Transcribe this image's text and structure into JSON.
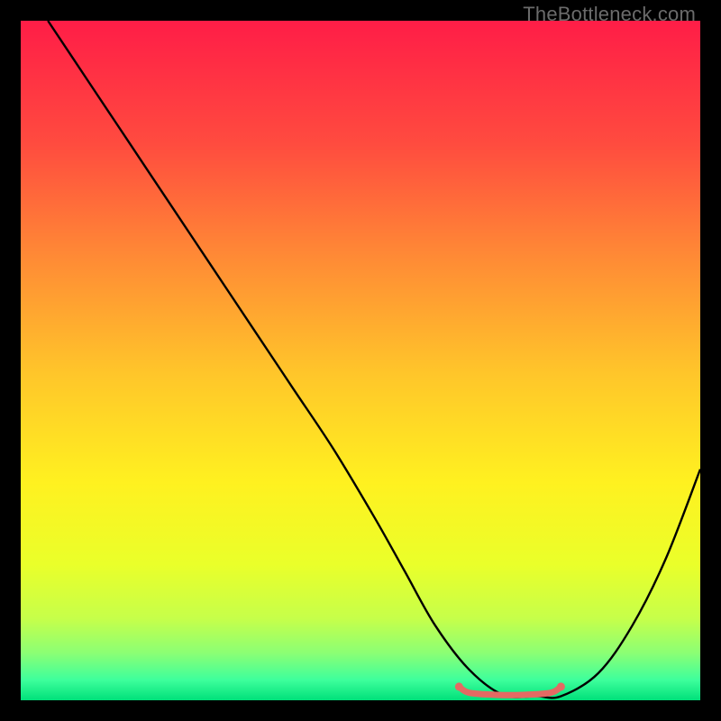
{
  "watermark": "TheBottleneck.com",
  "chart_data": {
    "type": "line",
    "title": "",
    "xlabel": "",
    "ylabel": "",
    "xlim": [
      0,
      100
    ],
    "ylim": [
      0,
      100
    ],
    "grid": false,
    "legend": false,
    "background_gradient": {
      "stops": [
        {
          "offset": 0.0,
          "color": "#ff1d47"
        },
        {
          "offset": 0.18,
          "color": "#ff4b3f"
        },
        {
          "offset": 0.35,
          "color": "#ff8b35"
        },
        {
          "offset": 0.52,
          "color": "#ffc62a"
        },
        {
          "offset": 0.68,
          "color": "#fff120"
        },
        {
          "offset": 0.8,
          "color": "#eaff2a"
        },
        {
          "offset": 0.88,
          "color": "#c6ff4a"
        },
        {
          "offset": 0.93,
          "color": "#8cff74"
        },
        {
          "offset": 0.97,
          "color": "#3eff9c"
        },
        {
          "offset": 1.0,
          "color": "#00e07a"
        }
      ]
    },
    "series": [
      {
        "name": "bottleneck-curve",
        "type": "line",
        "x": [
          4,
          10,
          16,
          22,
          28,
          34,
          40,
          46,
          52,
          56.5,
          61,
          66,
          71,
          76,
          79.5,
          85,
          90,
          95,
          100
        ],
        "y": [
          100,
          91,
          82,
          73,
          64,
          55,
          46,
          37,
          27,
          19,
          11,
          4.5,
          0.8,
          0.6,
          0.6,
          4,
          11,
          21,
          34
        ]
      },
      {
        "name": "flat-min-segment",
        "type": "line",
        "x": [
          64.5,
          66,
          70,
          74,
          78,
          79.5
        ],
        "y": [
          2.0,
          1.1,
          0.8,
          0.8,
          1.1,
          2.0
        ],
        "color": "#e46a63",
        "width": 7,
        "cap": "round"
      }
    ],
    "markers": [
      {
        "name": "min-left-dot",
        "x": 64.5,
        "y": 2.0,
        "r": 4.5,
        "color": "#e46a63"
      },
      {
        "name": "min-right-dot",
        "x": 79.5,
        "y": 2.0,
        "r": 4.5,
        "color": "#e46a63"
      }
    ]
  }
}
